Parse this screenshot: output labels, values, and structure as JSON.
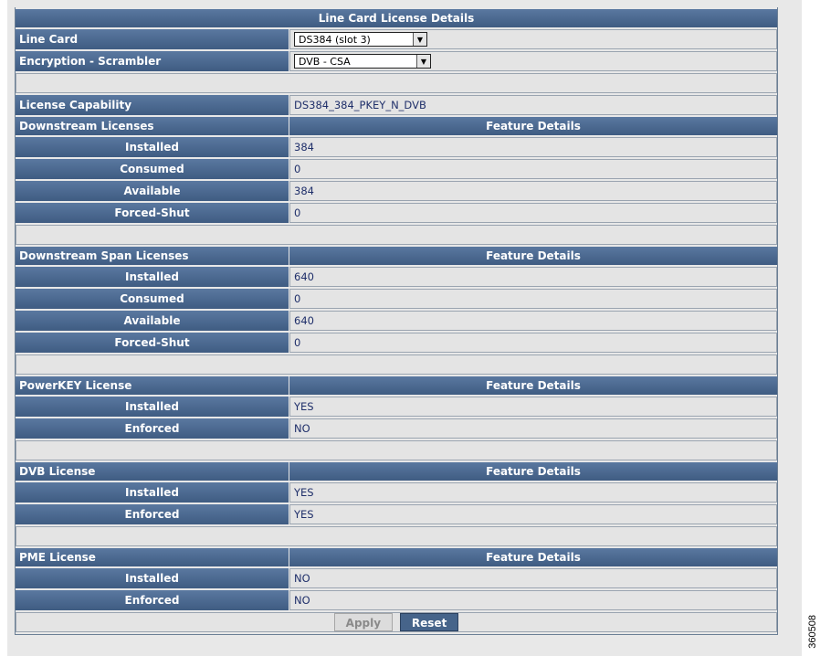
{
  "title": "Line Card License Details",
  "line_card": {
    "label": "Line Card",
    "value": "DS384 (slot 3)"
  },
  "encryption": {
    "label": "Encryption - Scrambler",
    "value": "DVB - CSA"
  },
  "license_capability": {
    "label": "License Capability",
    "value": "DS384_384_PKEY_N_DVB"
  },
  "feature_details_header": "Feature Details",
  "downstream": {
    "label": "Downstream Licenses",
    "rows": [
      {
        "label": "Installed",
        "value": "384"
      },
      {
        "label": "Consumed",
        "value": "0"
      },
      {
        "label": "Available",
        "value": "384"
      },
      {
        "label": "Forced-Shut",
        "value": "0"
      }
    ]
  },
  "downstream_span": {
    "label": "Downstream Span Licenses",
    "rows": [
      {
        "label": "Installed",
        "value": "640"
      },
      {
        "label": "Consumed",
        "value": "0"
      },
      {
        "label": "Available",
        "value": "640"
      },
      {
        "label": "Forced-Shut",
        "value": "0"
      }
    ]
  },
  "powerkey": {
    "label": "PowerKEY License",
    "rows": [
      {
        "label": "Installed",
        "value": "YES"
      },
      {
        "label": "Enforced",
        "value": "NO"
      }
    ]
  },
  "dvb": {
    "label": "DVB License",
    "rows": [
      {
        "label": "Installed",
        "value": "YES"
      },
      {
        "label": "Enforced",
        "value": "YES"
      }
    ]
  },
  "pme": {
    "label": "PME License",
    "rows": [
      {
        "label": "Installed",
        "value": "NO"
      },
      {
        "label": "Enforced",
        "value": "NO"
      }
    ]
  },
  "buttons": {
    "apply": "Apply",
    "reset": "Reset"
  },
  "figure_number": "360508",
  "icons": {
    "dropdown": "chevron-down-icon"
  }
}
